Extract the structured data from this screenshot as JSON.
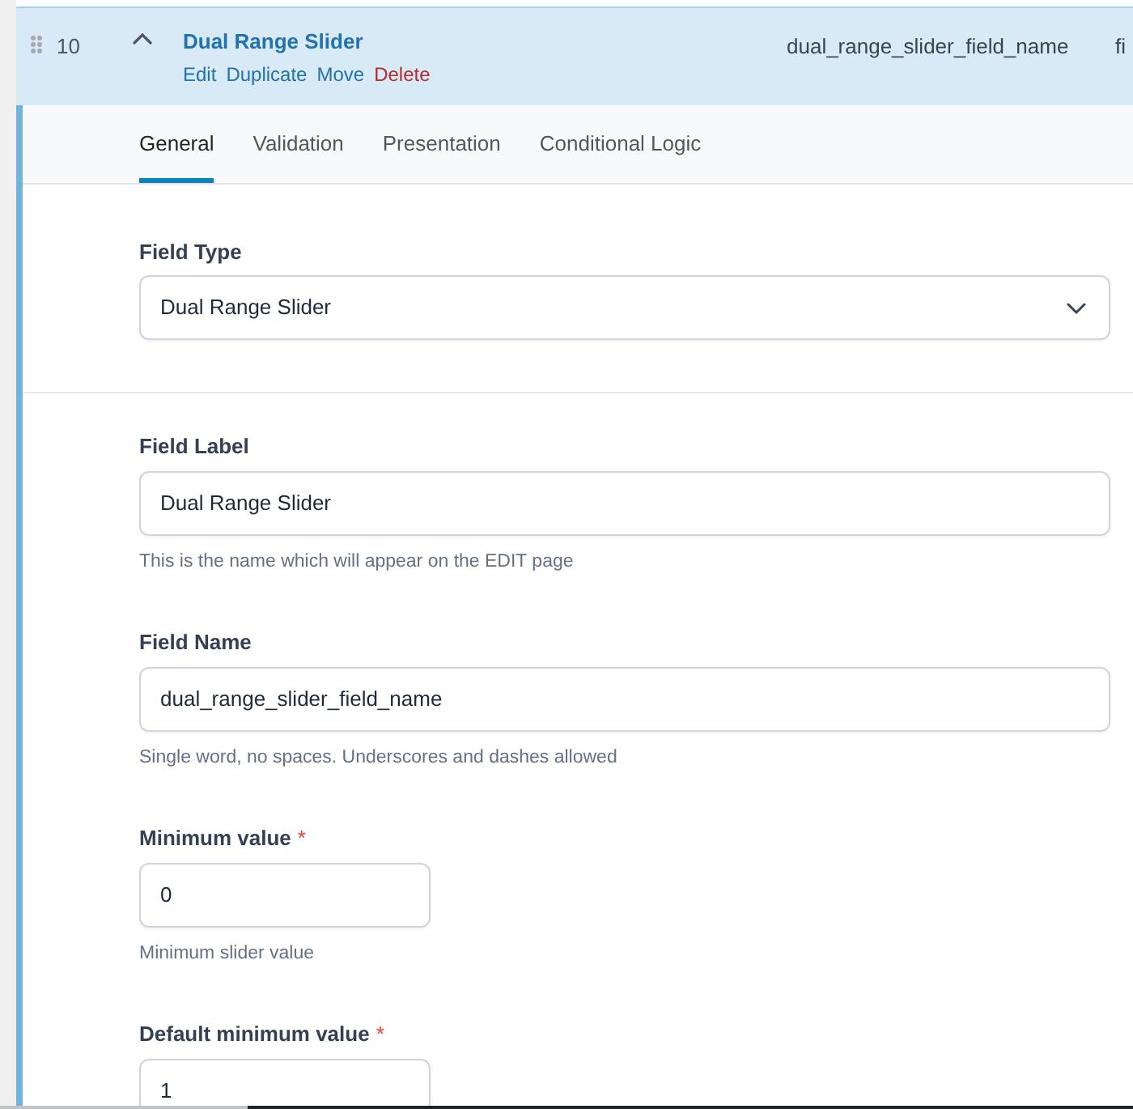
{
  "field_row": {
    "order": "10",
    "expanded": true,
    "title": "Dual Range Slider",
    "actions": [
      {
        "label": "Edit",
        "kind": "link"
      },
      {
        "label": "Duplicate",
        "kind": "link"
      },
      {
        "label": "Move",
        "kind": "link"
      },
      {
        "label": "Delete",
        "kind": "delete"
      }
    ],
    "name": "dual_range_slider_field_name",
    "column_4": "fi"
  },
  "tabs": [
    {
      "label": "General",
      "selected": true
    },
    {
      "label": "Validation",
      "selected": false
    },
    {
      "label": "Presentation",
      "selected": false
    },
    {
      "label": "Conditional Logic",
      "selected": false
    }
  ],
  "field_type": {
    "label": "Field Type",
    "value": "Dual Range Slider"
  },
  "settings": [
    {
      "kind": "text",
      "label": "Field Label",
      "value": "Dual Range Slider",
      "hint": "This is the name which will appear on the EDIT page"
    },
    {
      "kind": "text",
      "label": "Field Name",
      "value": "dual_range_slider_field_name",
      "hint": "Single word, no spaces. Underscores and dashes allowed"
    },
    {
      "kind": "number",
      "label": "Minimum value",
      "required_mark": "*",
      "value": "0",
      "hint": "Minimum slider value"
    },
    {
      "kind": "number",
      "label": "Default minimum value",
      "required_mark": "*",
      "value": "1"
    }
  ]
}
